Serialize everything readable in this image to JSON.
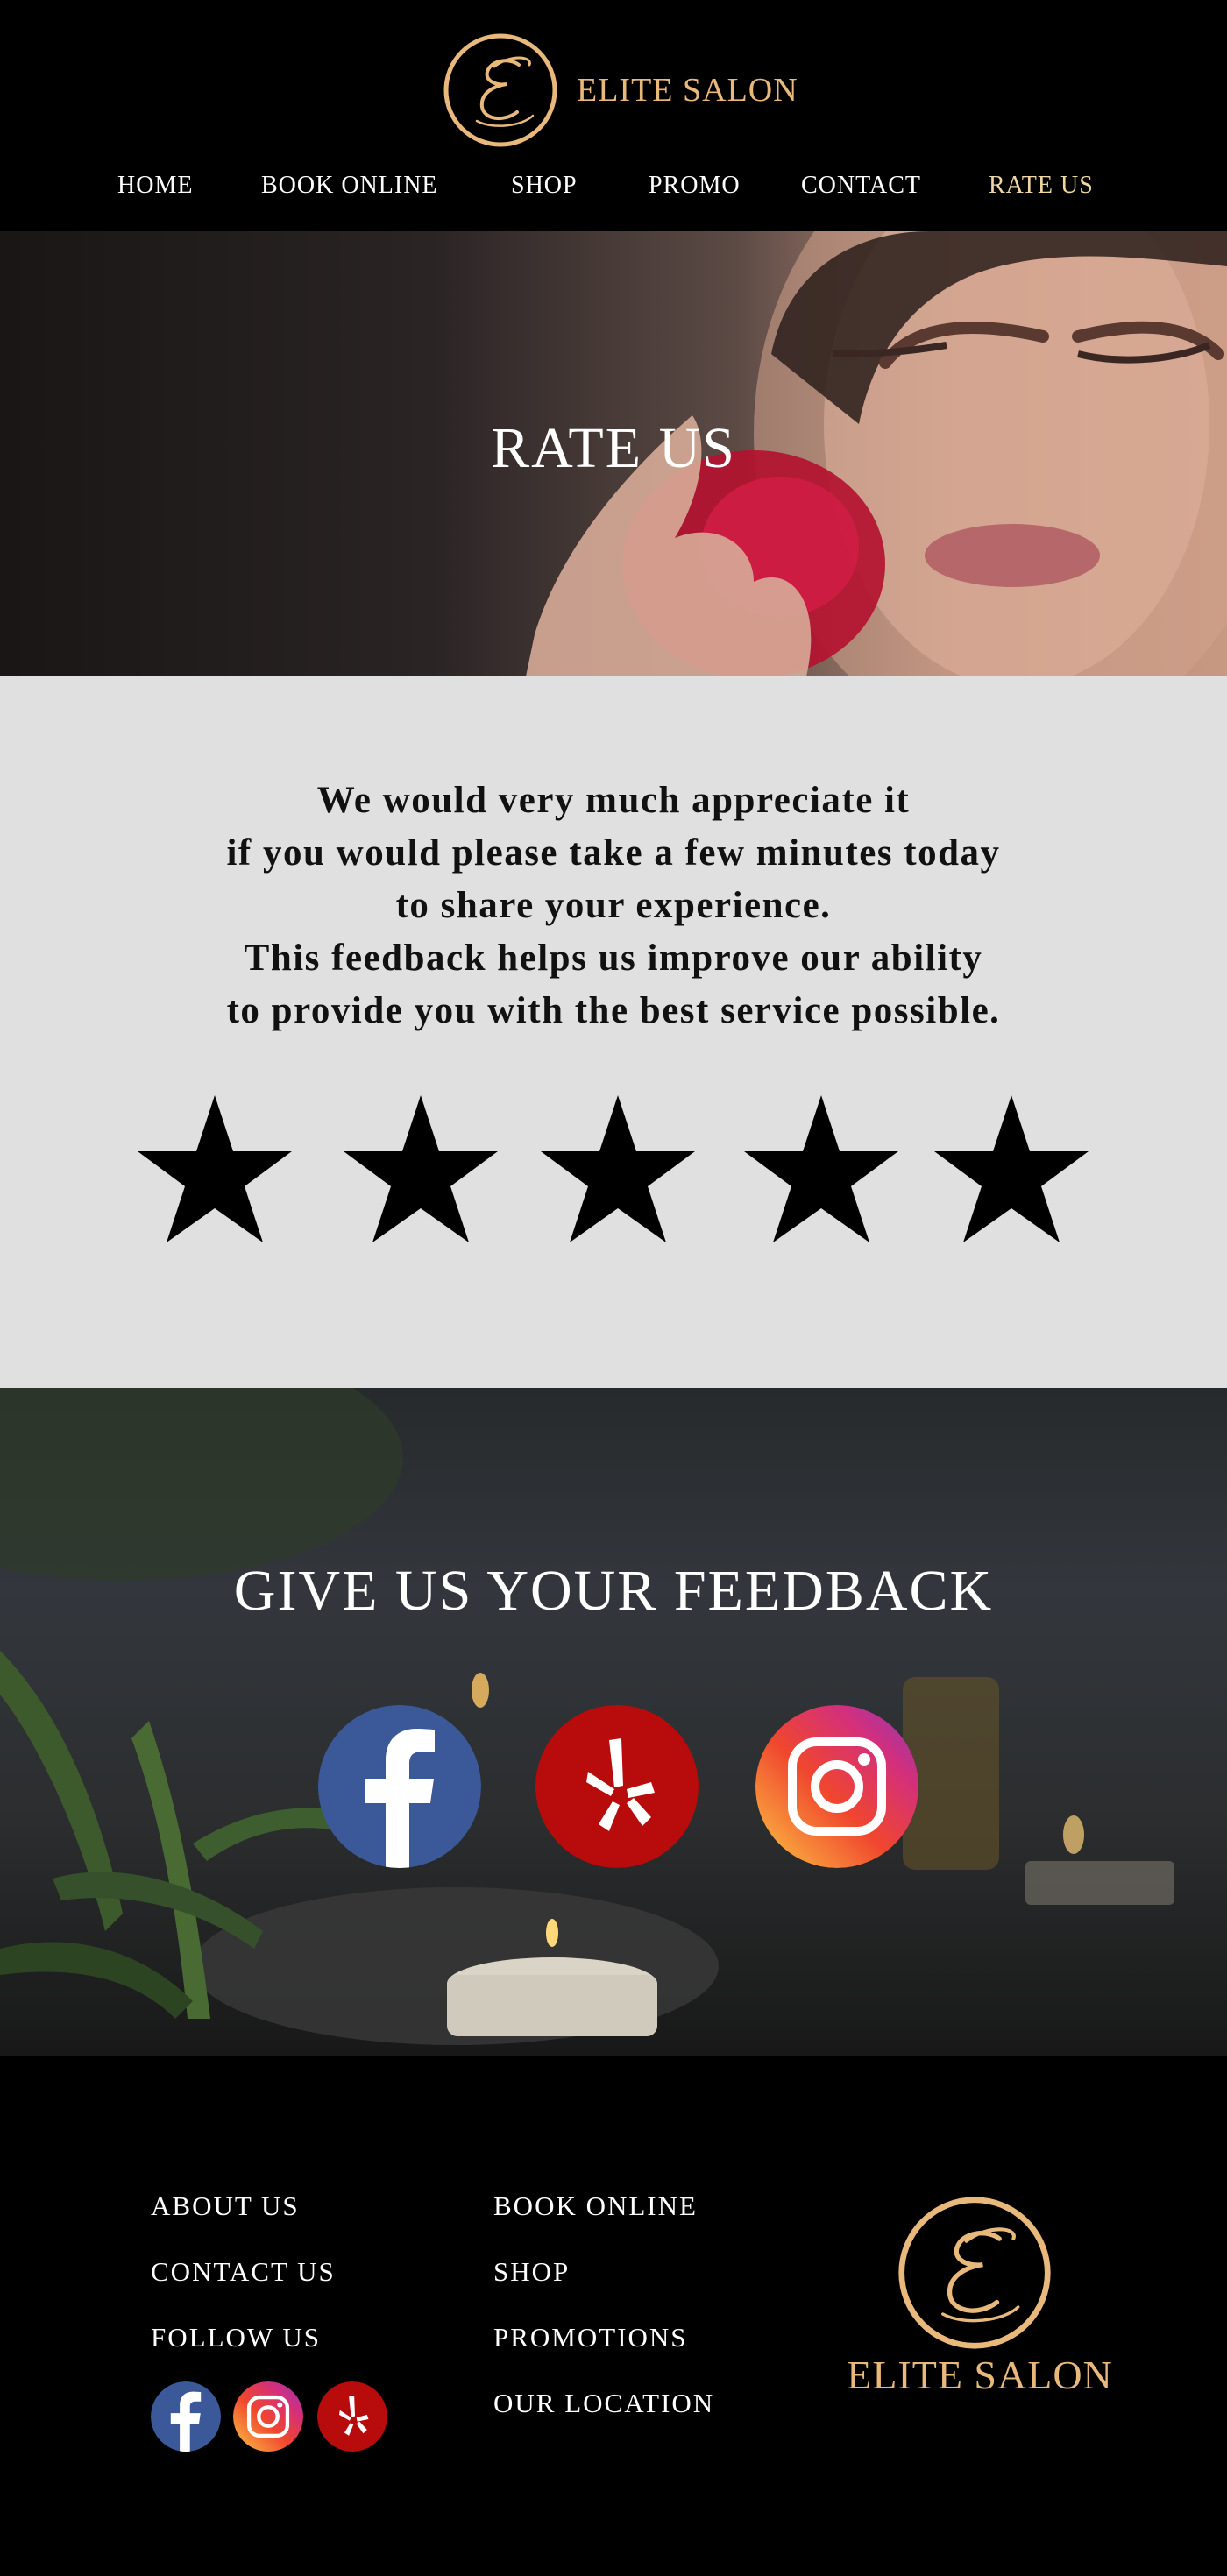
{
  "brand": {
    "name": "ELITE SALON",
    "accent_color": "#e9b97c"
  },
  "nav": {
    "items": [
      {
        "label": "HOME"
      },
      {
        "label": "BOOK ONLINE"
      },
      {
        "label": "SHOP"
      },
      {
        "label": "PROMO"
      },
      {
        "label": "CONTACT"
      },
      {
        "label": "RATE US",
        "active": true
      }
    ],
    "active_color": "#efd7a3"
  },
  "hero": {
    "title": "RATE US"
  },
  "rating": {
    "message_lines": [
      "We would very much appreciate it",
      "if you would please take a few minutes today",
      "to share your experience.",
      "This feedback helps us improve our ability",
      "to provide you with the best service possible."
    ],
    "star_count": 5,
    "star_icon": "star-icon"
  },
  "feedback": {
    "title": "GIVE US YOUR FEEDBACK",
    "socials": [
      "facebook-icon",
      "yelp-icon",
      "instagram-icon"
    ]
  },
  "footer": {
    "col1": [
      "ABOUT US",
      "CONTACT US",
      "FOLLOW US"
    ],
    "col2": [
      "BOOK ONLINE",
      "SHOP",
      "PROMOTIONS",
      "OUR LOCATION"
    ],
    "socials": [
      "facebook-icon",
      "instagram-icon",
      "yelp-icon"
    ],
    "logo_text": "ELITE SALON"
  },
  "colors": {
    "facebook": "#3b5998",
    "yelp": "#b80b0b",
    "instagram_from": "#fcb045",
    "instagram_to": "#833ab4"
  }
}
